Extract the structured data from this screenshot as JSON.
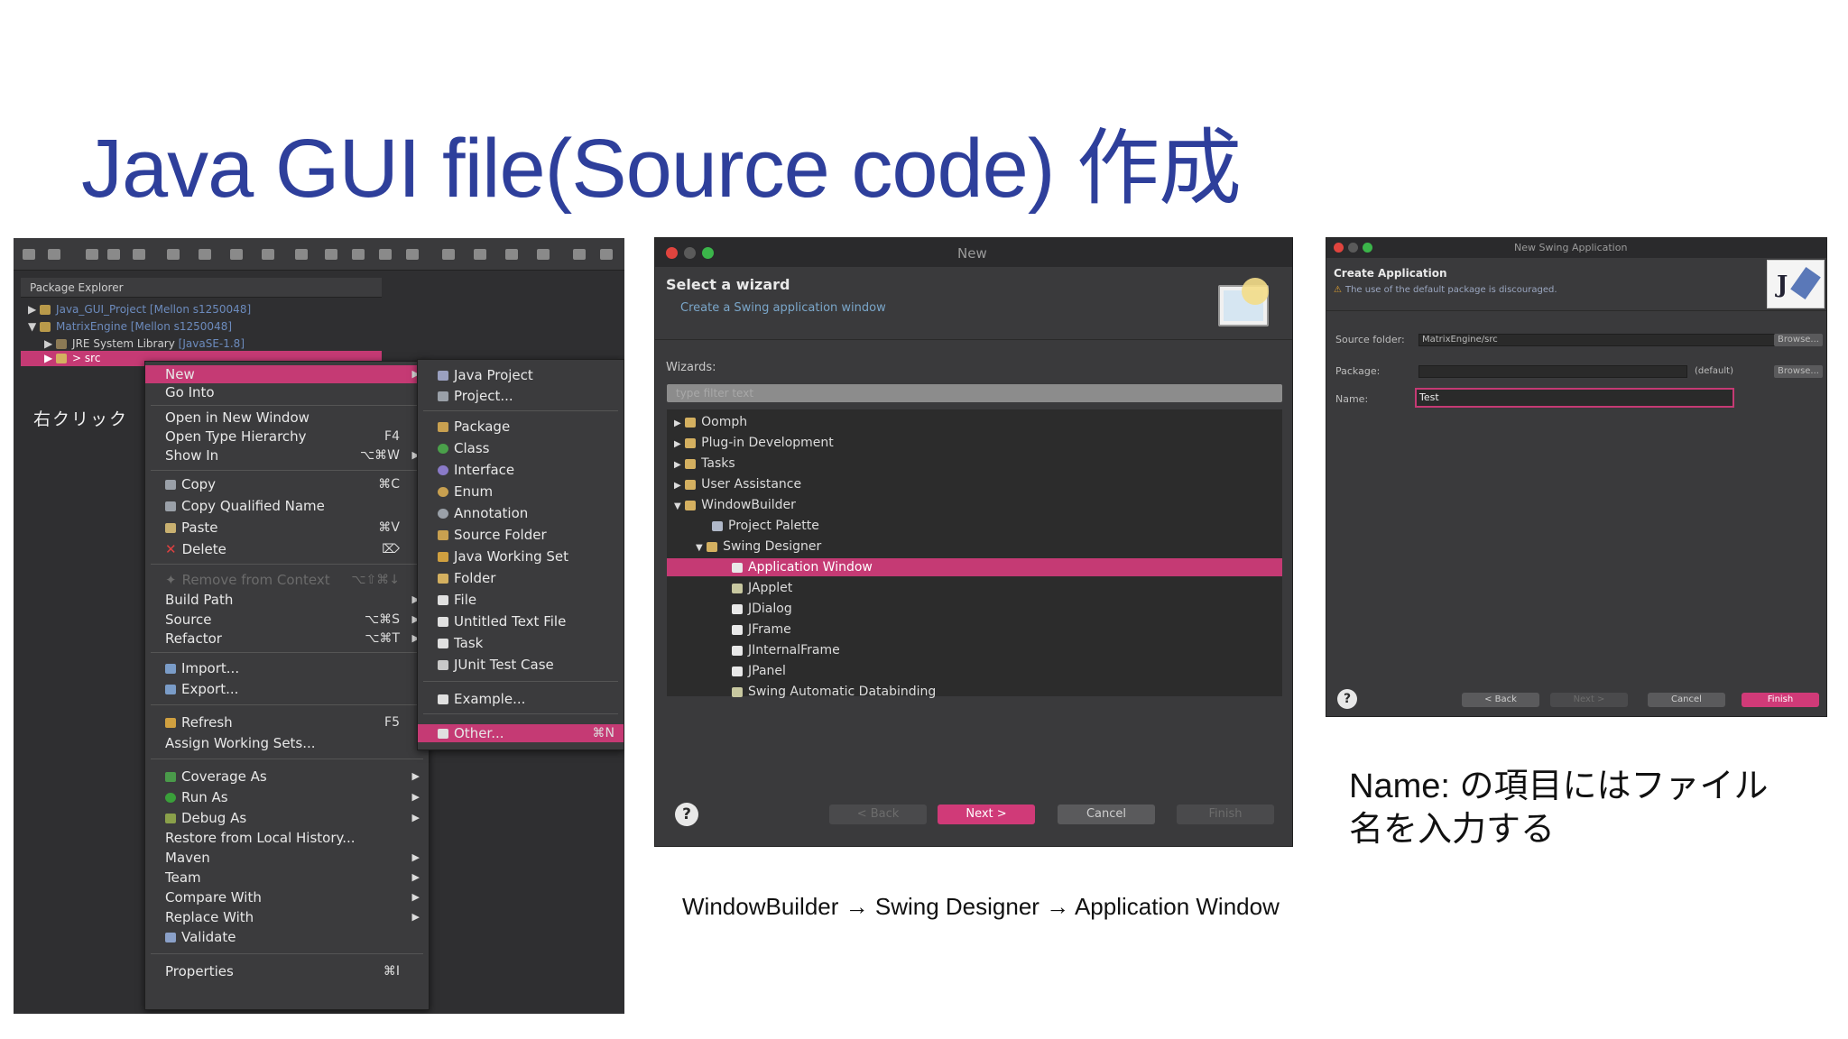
{
  "slide": {
    "title": "Java GUI file(Source code) 作成",
    "caption_wizard_path": "WindowBuilder → Swing Designer → Application Window",
    "caption_name": "Name: の項目にはファイル名を入力する",
    "caption_name_line1": "Name: の項目にはファイル",
    "caption_name_line2": "名を入力する"
  },
  "eclipse": {
    "package_explorer_label": "Package Explorer",
    "right_click_note": "右クリック",
    "tree": [
      {
        "label": "Java_GUI_Project",
        "suffix": "[Mellon s1250048]"
      },
      {
        "label": "MatrixEngine",
        "suffix": "[Mellon s1250048]"
      },
      {
        "label": "JRE System Library",
        "suffix": "[JavaSE-1.8]"
      },
      {
        "label": "> src",
        "suffix": ""
      }
    ],
    "context_menu": [
      {
        "label": "New",
        "shortcut": "",
        "arrow": "▶",
        "highlight": true
      },
      {
        "label": "Go Into",
        "shortcut": ""
      },
      {
        "label": "Open in New Window",
        "shortcut": ""
      },
      {
        "label": "Open Type Hierarchy",
        "shortcut": "F4"
      },
      {
        "label": "Show In",
        "shortcut": "⌥⌘W",
        "arrow": "▶"
      },
      {
        "label": "Copy",
        "shortcut": "⌘C"
      },
      {
        "label": "Copy Qualified Name",
        "shortcut": ""
      },
      {
        "label": "Paste",
        "shortcut": "⌘V"
      },
      {
        "label": "Delete",
        "shortcut": "⌦"
      },
      {
        "label": "Remove from Context",
        "shortcut": "⌥⇧⌘↓",
        "disabled": true
      },
      {
        "label": "Build Path",
        "shortcut": "",
        "arrow": "▶"
      },
      {
        "label": "Source",
        "shortcut": "⌥⌘S",
        "arrow": "▶"
      },
      {
        "label": "Refactor",
        "shortcut": "⌥⌘T",
        "arrow": "▶"
      },
      {
        "label": "Import...",
        "shortcut": ""
      },
      {
        "label": "Export...",
        "shortcut": ""
      },
      {
        "label": "Refresh",
        "shortcut": "F5"
      },
      {
        "label": "Assign Working Sets...",
        "shortcut": ""
      },
      {
        "label": "Coverage As",
        "shortcut": "",
        "arrow": "▶"
      },
      {
        "label": "Run As",
        "shortcut": "",
        "arrow": "▶"
      },
      {
        "label": "Debug As",
        "shortcut": "",
        "arrow": "▶"
      },
      {
        "label": "Restore from Local History...",
        "shortcut": ""
      },
      {
        "label": "Maven",
        "shortcut": "",
        "arrow": "▶"
      },
      {
        "label": "Team",
        "shortcut": "",
        "arrow": "▶"
      },
      {
        "label": "Compare With",
        "shortcut": "",
        "arrow": "▶"
      },
      {
        "label": "Replace With",
        "shortcut": "",
        "arrow": "▶"
      },
      {
        "label": "Validate",
        "shortcut": ""
      },
      {
        "label": "Properties",
        "shortcut": "⌘I"
      }
    ],
    "submenu": [
      {
        "label": "Java Project",
        "shortcut": ""
      },
      {
        "label": "Project...",
        "shortcut": ""
      },
      {
        "label": "Package",
        "shortcut": ""
      },
      {
        "label": "Class",
        "shortcut": ""
      },
      {
        "label": "Interface",
        "shortcut": ""
      },
      {
        "label": "Enum",
        "shortcut": ""
      },
      {
        "label": "Annotation",
        "shortcut": ""
      },
      {
        "label": "Source Folder",
        "shortcut": ""
      },
      {
        "label": "Java Working Set",
        "shortcut": ""
      },
      {
        "label": "Folder",
        "shortcut": ""
      },
      {
        "label": "File",
        "shortcut": ""
      },
      {
        "label": "Untitled Text File",
        "shortcut": ""
      },
      {
        "label": "Task",
        "shortcut": ""
      },
      {
        "label": "JUnit Test Case",
        "shortcut": ""
      },
      {
        "label": "Example...",
        "shortcut": ""
      },
      {
        "label": "Other...",
        "shortcut": "⌘N",
        "highlight": true
      }
    ]
  },
  "wizard": {
    "window_title": "New",
    "heading": "Select a wizard",
    "subheading": "Create a Swing application window",
    "wizards_label": "Wizards:",
    "filter_placeholder": "type filter text",
    "items": [
      {
        "label": "Oomph",
        "level": 0,
        "arrow": "▶"
      },
      {
        "label": "Plug-in Development",
        "level": 0,
        "arrow": "▶"
      },
      {
        "label": "Tasks",
        "level": 0,
        "arrow": "▶"
      },
      {
        "label": "User Assistance",
        "level": 0,
        "arrow": "▶"
      },
      {
        "label": "WindowBuilder",
        "level": 0,
        "arrow": "▼"
      },
      {
        "label": "Project Palette",
        "level": 1,
        "arrow": ""
      },
      {
        "label": "Swing Designer",
        "level": 1,
        "arrow": "▼"
      },
      {
        "label": "Application Window",
        "level": 2,
        "arrow": "",
        "highlight": true
      },
      {
        "label": "JApplet",
        "level": 2,
        "arrow": ""
      },
      {
        "label": "JDialog",
        "level": 2,
        "arrow": ""
      },
      {
        "label": "JFrame",
        "level": 2,
        "arrow": ""
      },
      {
        "label": "JInternalFrame",
        "level": 2,
        "arrow": ""
      },
      {
        "label": "JPanel",
        "level": 2,
        "arrow": ""
      },
      {
        "label": "Swing Automatic Databinding",
        "level": 2,
        "arrow": ""
      }
    ],
    "buttons": {
      "back": "< Back",
      "next": "Next >",
      "cancel": "Cancel",
      "finish": "Finish"
    },
    "help": "?"
  },
  "swing_app": {
    "window_title": "New Swing Application",
    "heading": "Create Application",
    "warning": "The use of the default package is discouraged.",
    "source_folder_label": "Source folder:",
    "source_folder_value": "MatrixEngine/src",
    "package_label": "Package:",
    "package_value": "",
    "package_default": "(default)",
    "name_label": "Name:",
    "name_value": "Test",
    "browse": "Browse...",
    "buttons": {
      "back": "< Back",
      "next": "Next >",
      "cancel": "Cancel",
      "finish": "Finish"
    },
    "help": "?"
  },
  "colors": {
    "title": "#2e3f9b",
    "highlight": "#c53a74",
    "dark_bg": "#2f2f31"
  }
}
